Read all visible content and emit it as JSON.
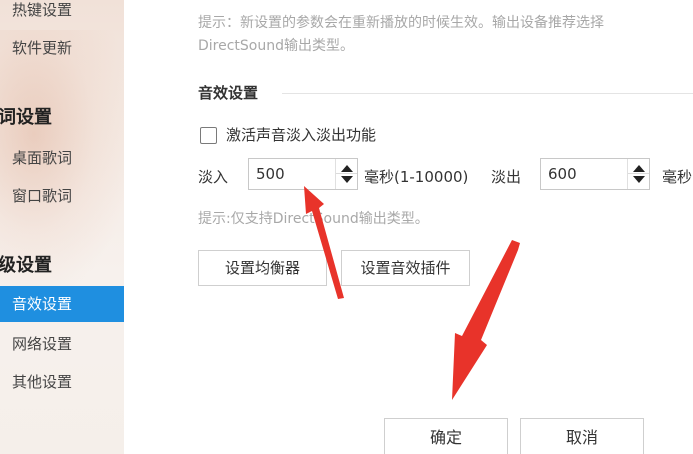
{
  "sidebar": {
    "items": [
      {
        "label": "热键设置",
        "type": "item"
      },
      {
        "label": "软件更新",
        "type": "item"
      },
      {
        "label": "词设置",
        "type": "group"
      },
      {
        "label": "桌面歌词",
        "type": "item"
      },
      {
        "label": "窗口歌词",
        "type": "item"
      },
      {
        "label": "级设置",
        "type": "group"
      },
      {
        "label": "音效设置",
        "type": "item",
        "active": true
      },
      {
        "label": "网络设置",
        "type": "item"
      },
      {
        "label": "其他设置",
        "type": "item"
      }
    ]
  },
  "main": {
    "top_hint_line1": "提示：新设置的参数会在重新播放的时候生效。输出设备推荐选择",
    "top_hint_line2": "DirectSound输出类型。",
    "section_title": "音效设置",
    "fade_checkbox": {
      "label": "激活声音淡入淡出功能",
      "checked": false
    },
    "fade_in": {
      "label": "淡入",
      "value": "500",
      "unit": "毫秒(1-10000)"
    },
    "fade_out": {
      "label": "淡出",
      "value": "600",
      "unit": "毫秒"
    },
    "fade_hint": "提示:仅支持DirectSound输出类型。",
    "buttons": {
      "equalizer": "设置均衡器",
      "plugin": "设置音效插件"
    },
    "footer": {
      "ok": "确定",
      "cancel": "取消"
    }
  },
  "colors": {
    "accent": "#1f8fe0",
    "annotation": "#e8332a"
  },
  "icons": {
    "spin_up": "caret-up-icon",
    "spin_down": "caret-down-icon"
  }
}
